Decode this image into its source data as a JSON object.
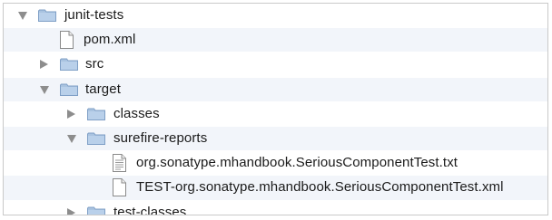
{
  "tree": {
    "items": [
      {
        "label": "junit-tests",
        "type": "folder",
        "depth": 0,
        "expander": "expanded"
      },
      {
        "label": "pom.xml",
        "type": "file",
        "depth": 1,
        "expander": "none"
      },
      {
        "label": "src",
        "type": "folder",
        "depth": 1,
        "expander": "collapsed"
      },
      {
        "label": "target",
        "type": "folder",
        "depth": 1,
        "expander": "expanded"
      },
      {
        "label": "classes",
        "type": "folder",
        "depth": 2,
        "expander": "collapsed"
      },
      {
        "label": "surefire-reports",
        "type": "folder",
        "depth": 2,
        "expander": "expanded"
      },
      {
        "label": "org.sonatype.mhandbook.SeriousComponentTest.txt",
        "type": "text-file",
        "depth": 3,
        "expander": "none"
      },
      {
        "label": "TEST-org.sonatype.mhandbook.SeriousComponentTest.xml",
        "type": "file",
        "depth": 3,
        "expander": "none"
      },
      {
        "label": "test-classes",
        "type": "folder",
        "depth": 2,
        "expander": "collapsed"
      }
    ]
  },
  "colors": {
    "folder": "#a9c3e0",
    "folder_dark": "#7f9fc6",
    "alt_row": "#f2f5fa",
    "triangle": "#8d8d8d"
  }
}
